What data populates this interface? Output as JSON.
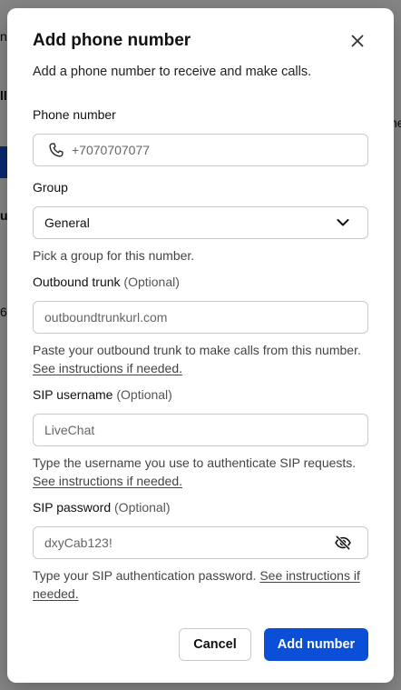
{
  "background": {
    "fragments": [
      "n",
      "ll",
      "he",
      "u",
      "6"
    ]
  },
  "modal": {
    "title": "Add phone number",
    "subtitle": "Add a phone number to receive and make calls.",
    "phone": {
      "label": "Phone number",
      "value": "+7070707077",
      "icon": "phone-icon"
    },
    "group": {
      "label": "Group",
      "selected": "General",
      "help": "Pick a group for this number.",
      "icon": "chevron-down-icon"
    },
    "outbound_trunk": {
      "label": "Outbound trunk",
      "optional": "(Optional)",
      "placeholder": "outboundtrunkurl.com",
      "help": "Paste your outbound trunk to make calls from this number.",
      "link": "See instructions if needed."
    },
    "sip_username": {
      "label": "SIP username",
      "optional": "(Optional)",
      "value": "LiveChat",
      "help": "Type the username you use to authenticate SIP requests.",
      "link": "See instructions if needed."
    },
    "sip_password": {
      "label": "SIP password",
      "optional": "(Optional)",
      "value": "dxyCab123!",
      "help": "Type your SIP authentication password.",
      "link": "See instructions if needed.",
      "icon": "eye-off-icon"
    },
    "buttons": {
      "cancel": "Cancel",
      "add": "Add number"
    }
  },
  "colors": {
    "primary": "#0b4fd8",
    "border": "#c9c9c9",
    "overlay": "rgba(0,0,0,0.48)"
  }
}
